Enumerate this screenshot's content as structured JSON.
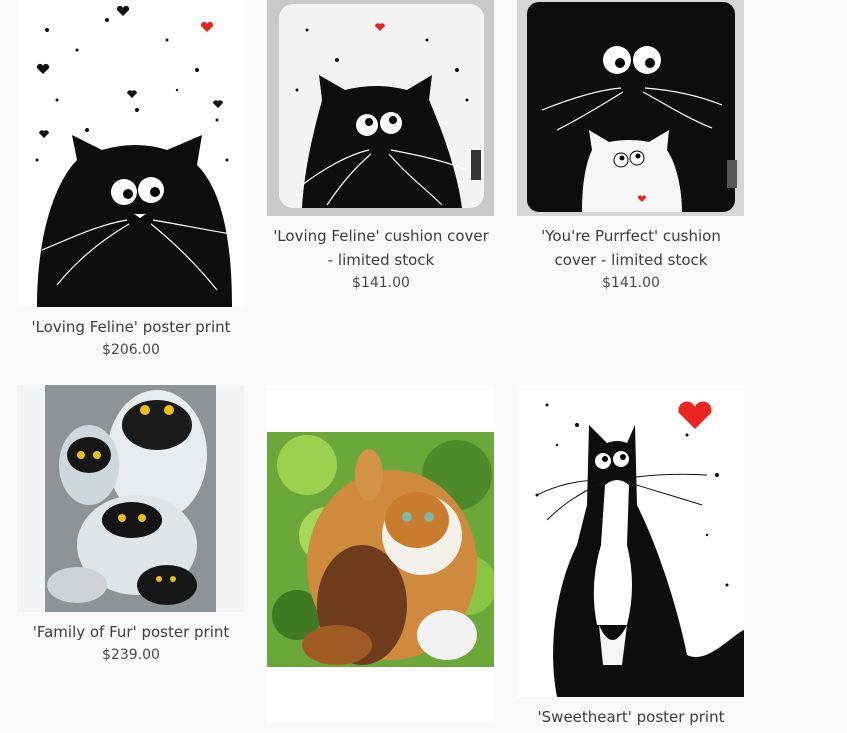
{
  "products": [
    {
      "title": "'Loving Feline' poster print",
      "price": "$206.00"
    },
    {
      "title": "'Loving Feline' cushion cover - limited stock",
      "price": "$141.00"
    },
    {
      "title": "'You're Purrfect' cushion cover - limited stock",
      "price": "$141.00"
    },
    {
      "title": "'Family of Fur' poster print",
      "price": "$239.00"
    },
    {
      "title": "",
      "price": ""
    },
    {
      "title": "'Sweetheart' poster print",
      "price": ""
    }
  ],
  "colors": {
    "background": "#fafafa",
    "text": "#3d3d3d",
    "heart": "#e8261f"
  }
}
